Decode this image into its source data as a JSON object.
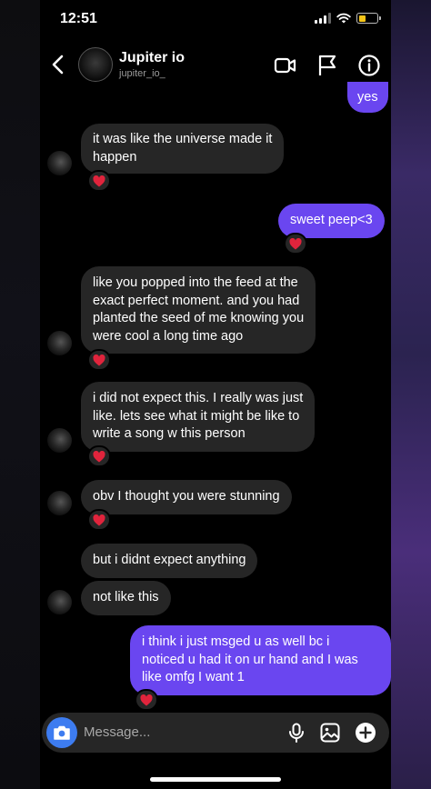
{
  "status_bar": {
    "time": "12:51"
  },
  "header": {
    "name": "Jupiter io",
    "username": "jupiter_io_"
  },
  "messages": [
    {
      "side": "out",
      "text": "yes"
    },
    {
      "side": "in",
      "text": "it was like the universe made it\nhappen",
      "reaction": "heart"
    },
    {
      "side": "out",
      "text": "sweet peep<3",
      "reaction": "heart"
    },
    {
      "side": "in",
      "text": "like you popped into the feed at the\nexact perfect moment.  and you had\nplanted the seed of me knowing you\nwere cool a long time ago",
      "reaction": "heart"
    },
    {
      "side": "in",
      "text": "i did not expect this.  I really was just\nlike.  lets see what it might be like to\nwrite a song w this person",
      "reaction": "heart"
    },
    {
      "side": "in",
      "text": "obv I thought you were stunning",
      "reaction": "heart"
    },
    {
      "side": "in",
      "text": "but i didnt expect anything"
    },
    {
      "side": "in",
      "text": "not like this"
    },
    {
      "side": "out",
      "text": "i think i just msged u as well bc i\nnoticed u had it on ur hand and I was\nlike omfg I want 1",
      "reaction": "heart"
    }
  ],
  "composer": {
    "placeholder": "Message..."
  },
  "colors": {
    "outgoing": "#6a46f0",
    "incoming": "#262626",
    "camera": "#3d7cf0",
    "reaction": "#e0243c"
  },
  "icons": [
    "back-chevron-icon",
    "video-icon",
    "flag-icon",
    "info-icon",
    "camera-icon",
    "microphone-icon",
    "image-icon",
    "plus-icon",
    "heart-icon"
  ]
}
